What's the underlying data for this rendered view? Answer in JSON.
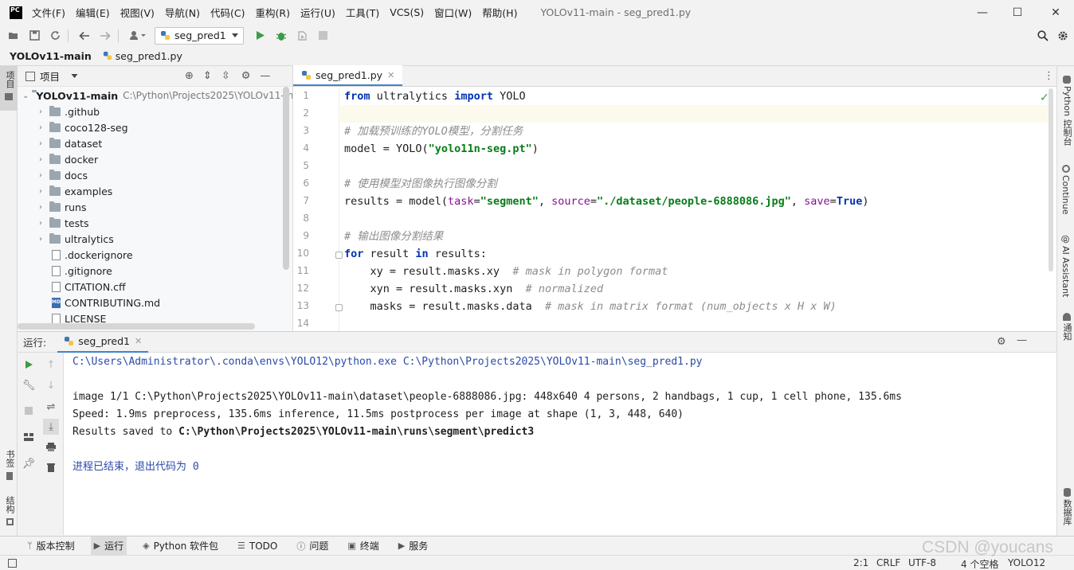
{
  "window": {
    "logo_text": "PC",
    "title": "YOLOv11-main - seg_pred1.py",
    "controls": {
      "minimize": "—",
      "maximize": "☐",
      "close": "✕"
    }
  },
  "menu": [
    "文件(F)",
    "编辑(E)",
    "视图(V)",
    "导航(N)",
    "代码(C)",
    "重构(R)",
    "运行(U)",
    "工具(T)",
    "VCS(S)",
    "窗口(W)",
    "帮助(H)"
  ],
  "toolbar": {
    "run_config": "seg_pred1",
    "icons": [
      "open-folder-icon",
      "save-icon",
      "sync-icon",
      "back-icon",
      "forward-icon",
      "user-icon",
      "run-icon",
      "debug-icon",
      "coverage-icon",
      "stop-icon",
      "search-icon",
      "settings-icon"
    ]
  },
  "breadcrumb": {
    "project": "YOLOv11-main",
    "file": "seg_pred1.py"
  },
  "left_stripe": {
    "project_tab": "项目",
    "bookmarks_tab": "书签",
    "structure_tab": "结构"
  },
  "right_stripe": {
    "python_console": "Python 控制台",
    "continue": "Continue",
    "ai_assistant": "AI Assistant",
    "notifications": "通知",
    "database": "数据库"
  },
  "project_panel": {
    "title": "项目",
    "root": {
      "name": "YOLOv11-main",
      "path": "C:\\Python\\Projects2025\\YOLOv11-m"
    },
    "folders": [
      ".github",
      "coco128-seg",
      "dataset",
      "docker",
      "docs",
      "examples",
      "runs",
      "tests",
      "ultralytics"
    ],
    "files": [
      {
        "name": ".dockerignore",
        "badge": ""
      },
      {
        "name": ".gitignore",
        "badge": ""
      },
      {
        "name": "CITATION.cff",
        "badge": ""
      },
      {
        "name": "CONTRIBUTING.md",
        "badge": "MD"
      },
      {
        "name": "LICENSE",
        "badge": ""
      }
    ]
  },
  "editor": {
    "tab": "seg_pred1.py",
    "line_numbers": [
      "1",
      "2",
      "3",
      "4",
      "5",
      "6",
      "7",
      "8",
      "9",
      "10",
      "11",
      "12",
      "13",
      "14"
    ],
    "code": {
      "l1": {
        "kw1": "from",
        "mod": " ultralytics ",
        "kw2": "import",
        "name": " YOLO"
      },
      "l3": "# 加载预训练的YOLO模型，分割任务",
      "l4": {
        "pre": "model = YOLO(",
        "str": "\"yolo11n-seg.pt\"",
        "post": ")"
      },
      "l6": "# 使用模型对图像执行图像分割",
      "l7": {
        "pre": "results = model(",
        "p1": "task",
        "eq1": "=",
        "s1": "\"segment\"",
        "c1": ", ",
        "p2": "source",
        "eq2": "=",
        "s2": "\"./dataset/people-6888086.jpg\"",
        "c2": ", ",
        "p3": "save",
        "eq3": "=",
        "kw": "True",
        "post": ")"
      },
      "l9": "# 输出图像分割结果",
      "l10": {
        "kw1": "for",
        "mid": " result ",
        "kw2": "in",
        "post": " results:"
      },
      "l11": {
        "code": "    xy = result.masks.xy  ",
        "cm": "# mask in polygon format"
      },
      "l12": {
        "code": "    xyn = result.masks.xyn  ",
        "cm": "# normalized"
      },
      "l13": {
        "code": "    masks = result.masks.data  ",
        "cm": "# mask in matrix format (num_objects x H x W)"
      }
    }
  },
  "run_panel": {
    "label": "运行:",
    "tab": "seg_pred1",
    "console": [
      "C:\\Users\\Administrator\\.conda\\envs\\YOLO12\\python.exe C:\\Python\\Projects2025\\YOLOv11-main\\seg_pred1.py",
      "",
      "image 1/1 C:\\Python\\Projects2025\\YOLOv11-main\\dataset\\people-6888086.jpg: 448x640 4 persons, 2 handbags, 1 cup, 1 cell phone, 135.6ms",
      "Speed: 1.9ms preprocess, 135.6ms inference, 11.5ms postprocess per image at shape (1, 3, 448, 640)",
      "Results saved to ",
      "",
      "进程已结束，退出代码为 0"
    ],
    "saved_path": "C:\\Python\\Projects2025\\YOLOv11-main\\runs\\segment\\predict3"
  },
  "tool_tabs": [
    "版本控制",
    "运行",
    "Python 软件包",
    "TODO",
    "问题",
    "终端",
    "服务"
  ],
  "status_bar": {
    "position": "2:1",
    "line_sep": "CRLF",
    "encoding": "UTF-8",
    "indent": "4 个空格",
    "interpreter": "YOLO12"
  },
  "watermark": "CSDN @youcans",
  "colors": {
    "accent": "#4083c9",
    "keyword": "#0033b3",
    "string": "#067d17",
    "comment": "#8c8c8c",
    "param": "#871094"
  }
}
